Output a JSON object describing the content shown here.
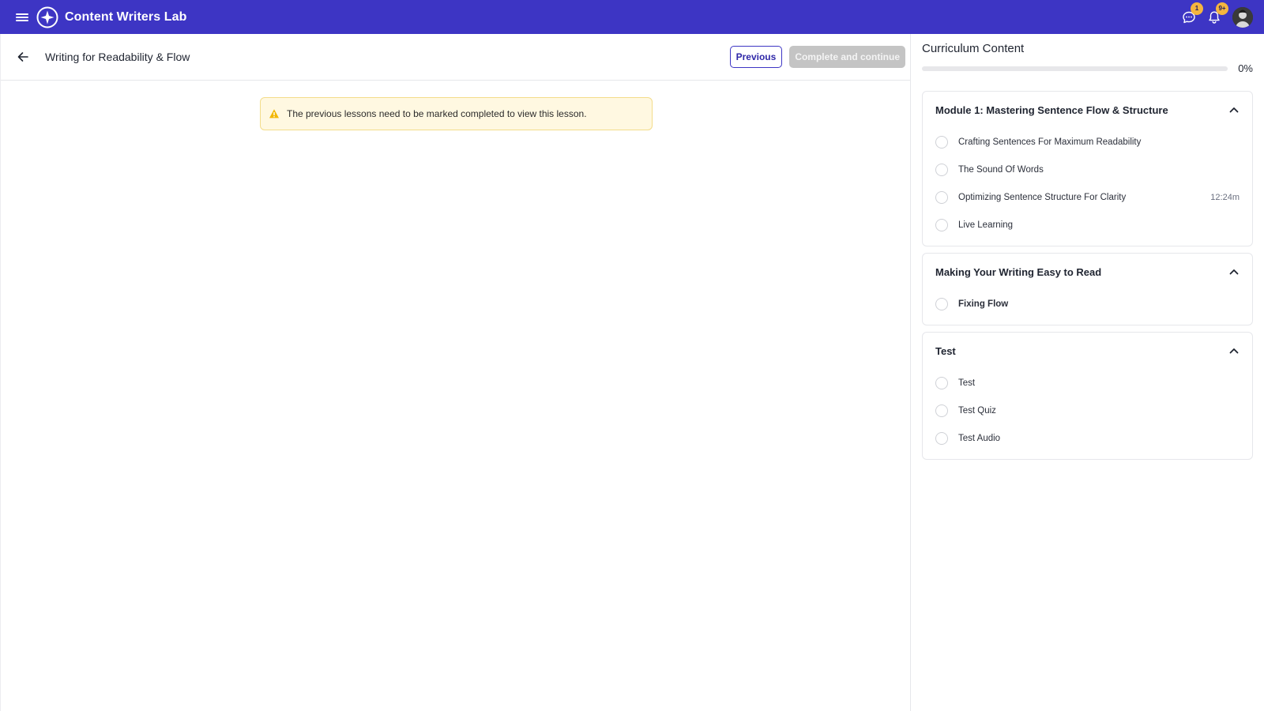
{
  "app": {
    "title": "Content Writers Lab"
  },
  "topbar": {
    "chat_badge": "1",
    "notif_badge": "9+"
  },
  "lesson": {
    "title": "Writing for Readability & Flow",
    "previous_label": "Previous",
    "complete_label": "Complete and continue",
    "warning": "The previous lessons need to be marked completed to view this lesson."
  },
  "curriculum": {
    "title": "Curriculum Content",
    "progress_label": "0%",
    "progress_fraction": 0,
    "modules": [
      {
        "title": "Module 1: Mastering Sentence Flow & Structure",
        "lessons": [
          {
            "name": "Crafting Sentences For Maximum Readability",
            "duration": ""
          },
          {
            "name": "The Sound Of Words",
            "duration": ""
          },
          {
            "name": "Optimizing Sentence Structure For Clarity",
            "duration": "12:24m"
          },
          {
            "name": "Live Learning",
            "duration": ""
          }
        ]
      },
      {
        "title": "Making Your Writing Easy to Read",
        "lessons": [
          {
            "name": "Fixing Flow",
            "duration": ""
          }
        ]
      },
      {
        "title": "Test",
        "lessons": [
          {
            "name": "Test",
            "duration": ""
          },
          {
            "name": "Test Quiz",
            "duration": ""
          },
          {
            "name": "Test Audio",
            "duration": ""
          }
        ]
      }
    ]
  },
  "colors": {
    "brand": "#3d35c4",
    "badge": "#f5b53f",
    "warning_bg": "#fff8e1",
    "warning_icon": "#f2b705",
    "disabled_button": "#c4c4c4"
  },
  "icons": {
    "menu": "hamburger-menu-icon",
    "logo": "star-logo-icon",
    "chat": "chat-bubble-icon",
    "bell": "bell-icon",
    "back": "arrow-left-icon",
    "warning": "warning-triangle-icon",
    "chevron": "chevron-up-icon"
  }
}
